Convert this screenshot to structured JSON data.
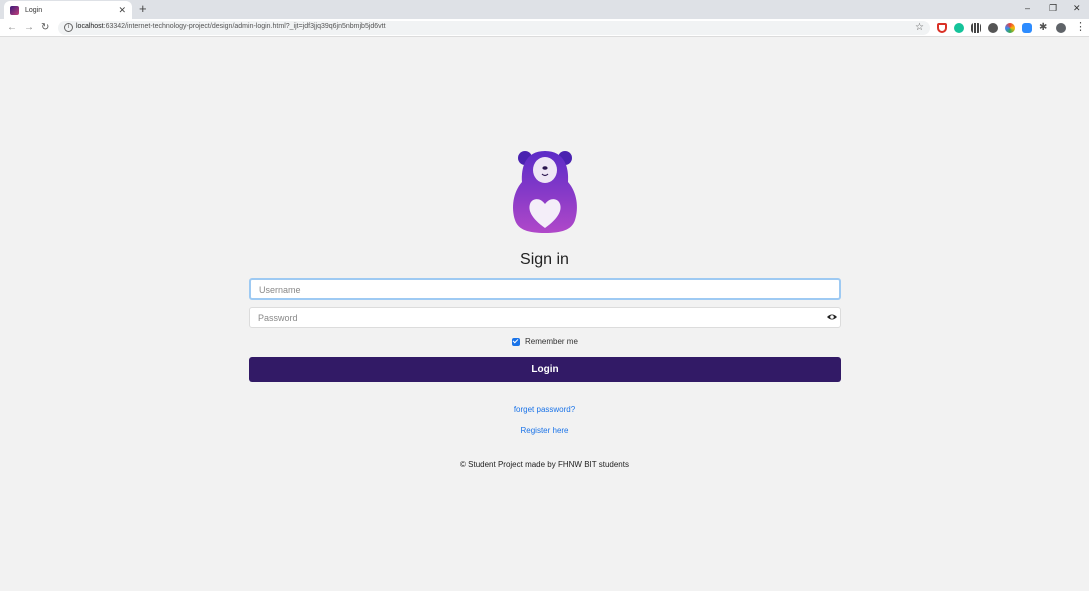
{
  "browser": {
    "tab_title": "Login",
    "new_tab": "+",
    "url_host": "localhost",
    "url_path": ":63342/internet-technology-project/design/admin-login.html?_ijt=jdf3jjq39q6jn5nbmjb5jd6vtt",
    "window_controls": {
      "minimize": "–",
      "restore": "❐",
      "close": "✕"
    },
    "nav": {
      "back": "←",
      "forward": "→",
      "reload": "↻"
    },
    "icons": [
      "info-icon",
      "star-icon",
      "extension-icons",
      "menu-icon"
    ],
    "accent_color": "#1a73e8"
  },
  "login": {
    "heading": "Sign in",
    "username_placeholder": "Username",
    "password_placeholder": "Password",
    "remember_label": "Remember me",
    "remember_checked": true,
    "submit_label": "Login",
    "button_color": "#321a66",
    "forgot_link": "forget password?",
    "register_link": "Register here",
    "footer": "© Student Project made by FHNW BIT students"
  }
}
